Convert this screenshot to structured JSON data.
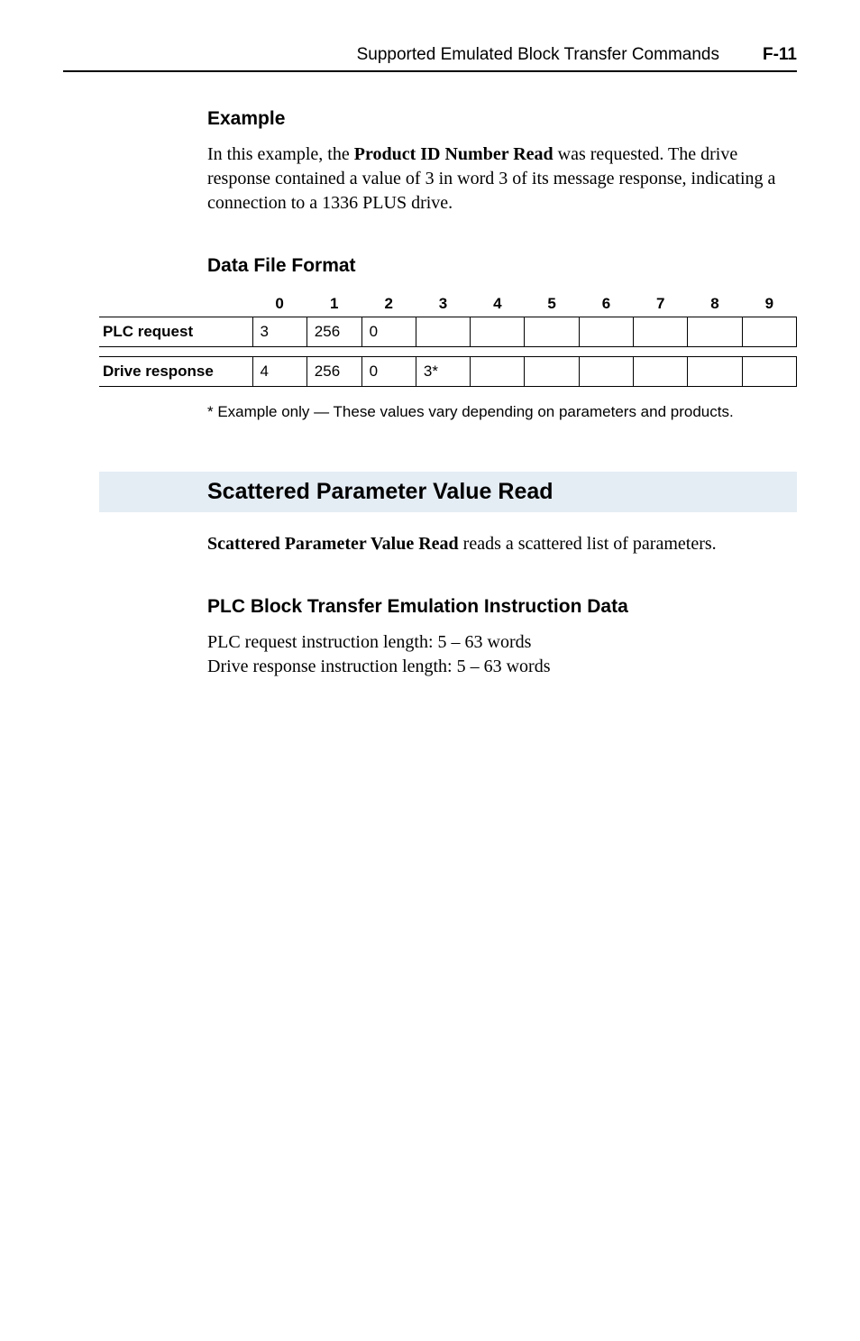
{
  "header": {
    "title": "Supported Emulated Block Transfer Commands",
    "page": "F-11"
  },
  "example": {
    "heading": "Example",
    "body": "In this example, the Product ID Number Read was requested. The drive response contained a value of 3 in word 3 of its message response, indicating a connection to a 1336 PLUS drive.",
    "bold_phrase": "Product ID Number Read"
  },
  "data_file": {
    "heading": "Data File Format",
    "col_headers": [
      "0",
      "1",
      "2",
      "3",
      "4",
      "5",
      "6",
      "7",
      "8",
      "9"
    ],
    "rows": [
      {
        "label": "PLC request",
        "cells": [
          "3",
          "256",
          "0",
          "",
          "",
          "",
          "",
          "",
          "",
          ""
        ]
      },
      {
        "label": "Drive response",
        "cells": [
          "4",
          "256",
          "0",
          "3*",
          "",
          "",
          "",
          "",
          "",
          ""
        ]
      }
    ],
    "footnote": "* Example only — These values vary depending on parameters and products."
  },
  "scattered": {
    "heading": "Scattered Parameter Value Read",
    "intro_bold": "Scattered Parameter Value Read",
    "intro_rest": " reads a scattered list of parameters.",
    "sub_heading": "PLC Block Transfer Emulation Instruction Data",
    "line1": "PLC request instruction length: 5 – 63 words",
    "line2": "Drive response instruction length: 5 – 63 words"
  },
  "chart_data": {
    "type": "table",
    "title": "Data File Format",
    "columns": [
      "0",
      "1",
      "2",
      "3",
      "4",
      "5",
      "6",
      "7",
      "8",
      "9"
    ],
    "series": [
      {
        "name": "PLC request",
        "values": [
          "3",
          "256",
          "0",
          "",
          "",
          "",
          "",
          "",
          "",
          ""
        ]
      },
      {
        "name": "Drive response",
        "values": [
          "4",
          "256",
          "0",
          "3*",
          "",
          "",
          "",
          "",
          "",
          ""
        ]
      }
    ],
    "note": "* Example only — These values vary depending on parameters and products."
  }
}
